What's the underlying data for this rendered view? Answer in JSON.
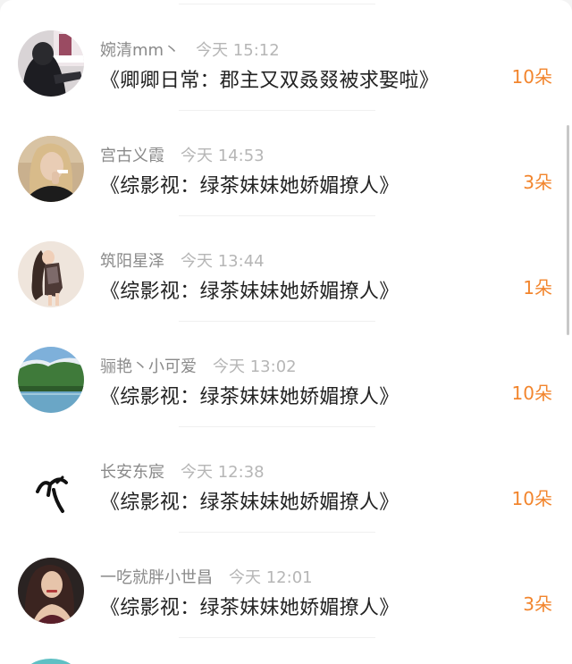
{
  "messages": [
    {
      "name": "婉清mm丶",
      "time": "今天 15:12",
      "title": "《卿卿日常：郡主又双叒叕被求娶啦》",
      "count": "10朵",
      "avatar": "dark-person-avatar"
    },
    {
      "name": "宫古义霞",
      "time": "今天 14:53",
      "title": "《综影视：绿茶妹妹她娇媚撩人》",
      "count": "3朵",
      "avatar": "blonde-woman-avatar"
    },
    {
      "name": "筑阳星泽",
      "time": "今天 13:44",
      "title": "《综影视：绿茶妹妹她娇媚撩人》",
      "count": "1朵",
      "avatar": "girl-dress-avatar"
    },
    {
      "name": "骊艳丶小可爱",
      "time": "今天 13:02",
      "title": "《综影视：绿茶妹妹她娇媚撩人》",
      "count": "10朵",
      "avatar": "landscape-avatar"
    },
    {
      "name": "长安东宸",
      "time": "今天 12:38",
      "title": "《综影视：绿茶妹妹她娇媚撩人》",
      "count": "10朵",
      "avatar": "calligraphy-avatar"
    },
    {
      "name": "一吃就胖小世昌",
      "time": "今天 12:01",
      "title": "《综影视：绿茶妹妹她娇媚撩人》",
      "count": "3朵",
      "avatar": "brunette-woman-avatar"
    }
  ],
  "colors": {
    "count": "#f2852d",
    "name": "#8a8a8a",
    "time": "#b6b6b6",
    "title": "#222222"
  }
}
